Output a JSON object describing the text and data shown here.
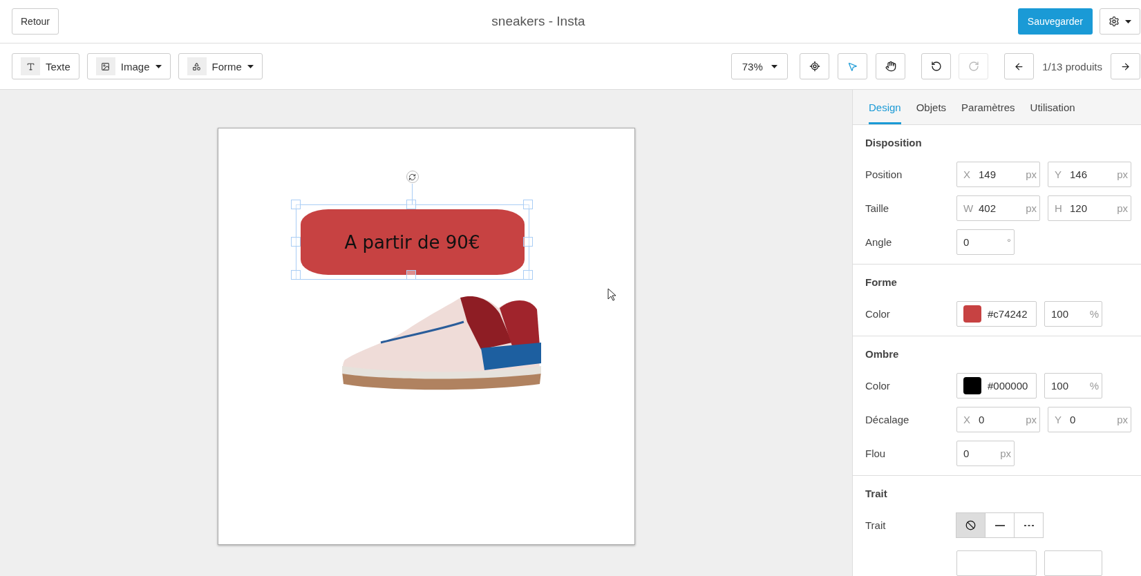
{
  "header": {
    "back": "Retour",
    "title": "sneakers - Insta",
    "save": "Sauvegarder"
  },
  "toolbar": {
    "insert": [
      {
        "kind": "text",
        "label": "Texte",
        "dropdown": false
      },
      {
        "kind": "image",
        "label": "Image",
        "dropdown": true
      },
      {
        "kind": "shape",
        "label": "Forme",
        "dropdown": true
      }
    ],
    "zoom": "73%",
    "tools": [
      {
        "kind": "locate",
        "selected": false
      },
      {
        "kind": "select",
        "selected": true
      },
      {
        "kind": "hand",
        "selected": false
      }
    ],
    "redo_disabled": true,
    "pager": "1/13 produits"
  },
  "canvas": {
    "shape": {
      "text": "A partir de 90€",
      "color": "#c74242",
      "selected": true
    }
  },
  "tabs": [
    {
      "label": "Design",
      "selected": true
    },
    {
      "label": "Objets",
      "selected": false
    },
    {
      "label": "Paramètres",
      "selected": false
    },
    {
      "label": "Utilisation",
      "selected": false
    }
  ],
  "sections": [
    {
      "title": "Disposition",
      "rows": [
        {
          "kind": "fields",
          "label": "Position",
          "fields": [
            {
              "prefix": "X",
              "value": "149",
              "unit": "px"
            },
            {
              "prefix": "Y",
              "value": "146",
              "unit": "px"
            }
          ]
        },
        {
          "kind": "fields",
          "label": "Taille",
          "fields": [
            {
              "prefix": "W",
              "value": "402",
              "unit": "px"
            },
            {
              "prefix": "H",
              "value": "120",
              "unit": "px"
            }
          ]
        },
        {
          "kind": "fields",
          "label": "Angle",
          "fields": [
            {
              "value": "0",
              "unit": "°",
              "small": true
            }
          ]
        }
      ]
    },
    {
      "title": "Forme",
      "rows": [
        {
          "kind": "color",
          "label": "Color",
          "color": "#c74242",
          "value": "#c74242",
          "opacity": "100",
          "unit": "%"
        }
      ]
    },
    {
      "title": "Ombre",
      "rows": [
        {
          "kind": "color",
          "label": "Color",
          "color": "#000000",
          "value": "#000000",
          "opacity": "100",
          "unit": "%"
        },
        {
          "kind": "fields",
          "label": "Décalage",
          "fields": [
            {
              "prefix": "X",
              "value": "0",
              "unit": "px"
            },
            {
              "prefix": "Y",
              "value": "0",
              "unit": "px"
            }
          ]
        },
        {
          "kind": "fields",
          "label": "Flou",
          "fields": [
            {
              "value": "0",
              "unit": "px",
              "small": true
            }
          ]
        }
      ]
    },
    {
      "title": "Trait",
      "rows": [
        {
          "kind": "stroke",
          "label": "Trait",
          "options": [
            {
              "kind": "none",
              "selected": true
            },
            {
              "kind": "solid",
              "selected": false
            },
            {
              "kind": "dashed",
              "selected": false
            }
          ]
        },
        {
          "kind": "cut"
        }
      ]
    }
  ]
}
